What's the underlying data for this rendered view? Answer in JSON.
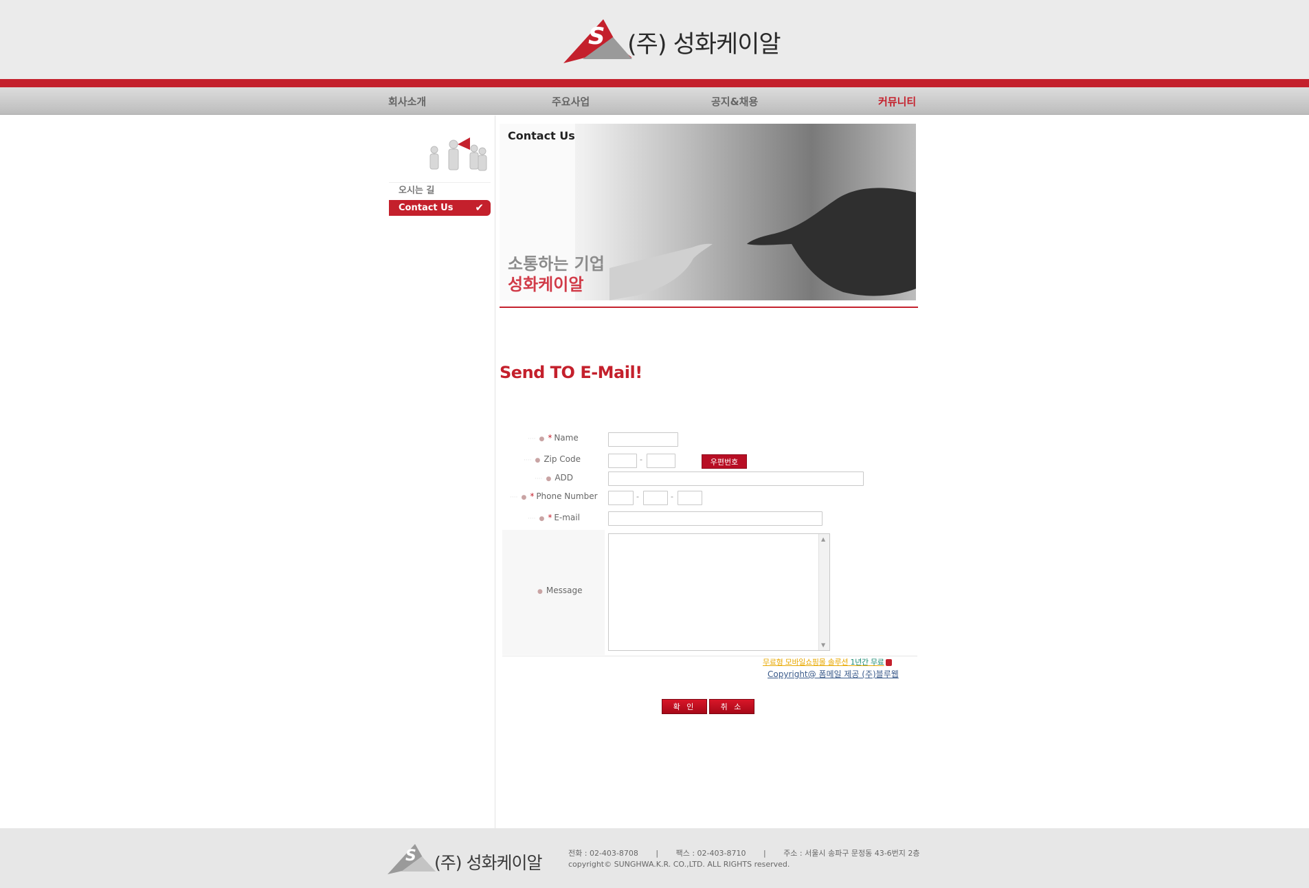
{
  "header": {
    "logo_text": "(주) 성화케이알",
    "nav": [
      {
        "label": "회사소개"
      },
      {
        "label": "주요사업"
      },
      {
        "label": "공지&채용"
      },
      {
        "label": "커뮤니티"
      }
    ]
  },
  "sidebar": {
    "items": [
      {
        "label": "오시는 길"
      },
      {
        "label": "Contact Us"
      }
    ]
  },
  "banner": {
    "title": "Contact Us",
    "slogan_line1": "소통하는 기업",
    "slogan_line2": "성화케이알"
  },
  "form": {
    "title": "Send TO E-Mail!",
    "name_label": "Name",
    "zip_label": "Zip Code",
    "zip_button": "우편번호",
    "add_label": "ADD",
    "phone_label": "Phone Number",
    "email_label": "E-mail",
    "message_label": "Message",
    "dash": "-",
    "promo_text": "무료형 모바일쇼핑몰 솔루션",
    "promo_highlight": "1년간 무료",
    "copyright_link": "Copyright@ 폼메일 제공 (주)블루웹",
    "confirm_button": "확 인",
    "cancel_button": "취 소"
  },
  "footer": {
    "logo_text": "(주) 성화케이알",
    "phone": "전화 : 02-403-8708",
    "fax": "팩스 : 02-403-8710",
    "address": "주소 : 서울시 송파구 문정동 43-6번지 2층",
    "separator": "|",
    "copyright": "copyright© SUNGHWA.K.R. CO.,LTD. ALL RIGHTS reserved."
  },
  "colors": {
    "accent": "#c4202c",
    "header_bg": "#ebebeb",
    "footer_bg": "#e7e7e7"
  }
}
